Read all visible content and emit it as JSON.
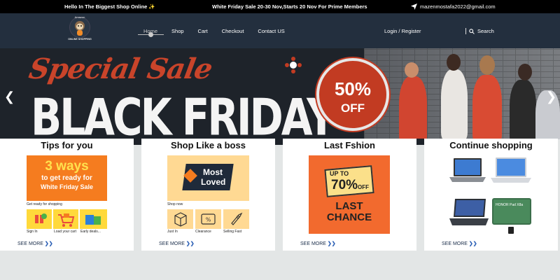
{
  "topbar": {
    "greeting": "Hello In The Biggest Shop Online ✨",
    "promo": "White Friday Sale 20-30 Nov,Starts 20 Nov For Prime Members",
    "email": "mazenmostafa2022@gmail.com"
  },
  "logo": {
    "top_text": "Amazon",
    "bottom_text": "ONLINE SHOPPING"
  },
  "nav": {
    "links": [
      "Home",
      "Shop",
      "Cart",
      "Checkout",
      "Contact US"
    ],
    "login": "Login / Register",
    "search": "Search"
  },
  "hero": {
    "special": "Special Sale",
    "headline": "BLACK FRIDAY",
    "badge_percent": "50%",
    "badge_off": "OFF"
  },
  "cards": [
    {
      "title": "Tips for you",
      "banner_line1": "3 ways",
      "banner_line2": "to get ready for",
      "banner_line3": "White Friday Sale",
      "caption": "Get ready for shopping",
      "items": [
        "Sign In",
        "Load your cart",
        "Early deals..."
      ],
      "see_more": "SEE MORE"
    },
    {
      "title": "Shop Like a boss",
      "banner_line1": "Most",
      "banner_line2": "Loved",
      "caption": "Shop now",
      "items": [
        "Just In",
        "Clearance",
        "Selling Fast"
      ],
      "see_more": "SEE MORE"
    },
    {
      "title": "Last Fshion",
      "up_to": "UP TO",
      "percent": "70%",
      "off": "OFF",
      "last": "LAST",
      "chance": "CHANCE",
      "see_more": "SEE MORE"
    },
    {
      "title": "Continue shopping",
      "tablet_brand": "HONOR Pad X8a",
      "see_more": "SEE MORE"
    }
  ],
  "colors": {
    "nav_bg": "#232f3e",
    "accent_red": "#c23b22",
    "orange": "#f57c1f",
    "link_blue": "#2b5fb5"
  }
}
